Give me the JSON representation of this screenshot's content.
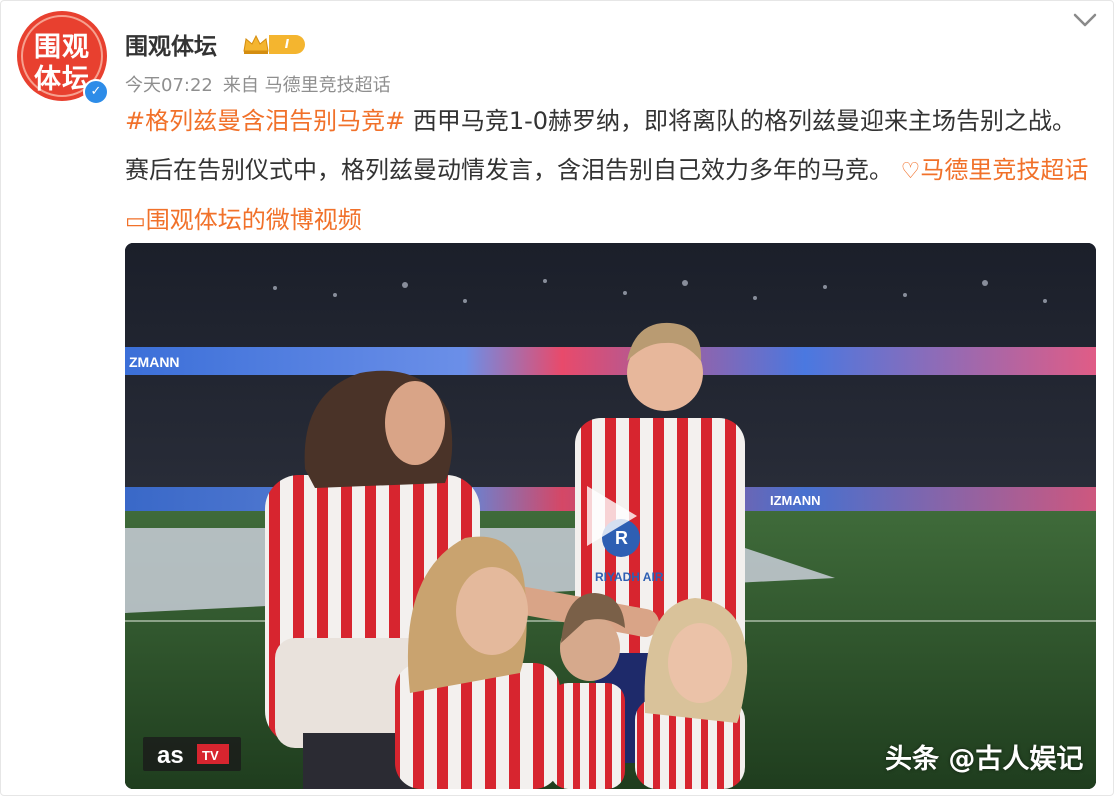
{
  "post": {
    "username": "围观体坛",
    "avatar_line1": "围观",
    "avatar_line2": "体坛",
    "level": "I",
    "time": "今天07:22",
    "source": "来自 马德里竞技超话"
  },
  "content": {
    "hashtag": "#格列兹曼含泪告别马竞#",
    "text": " 西甲马竞1-0赫罗纳，即将离队的格列兹曼迎来主场告别之战。赛后在告别仪式中，格列兹曼动情发言，含泪告别自己效力多年的马竞。",
    "topic_icon": "♡",
    "topic_link": "马德里竞技超话",
    "video_icon": "▭",
    "video_link": "围观体坛的微博视频"
  },
  "video": {
    "banner_left": "ZMANN",
    "banner_right": "IZMANN",
    "channel_logo": "as",
    "channel_tv": "TV",
    "sponsor": "RIYADH AIR"
  },
  "watermark": "头条 @古人娱记",
  "colors": {
    "accent": "#f1712a",
    "avatar_red": "#e8402f",
    "verified_blue": "#2d8ce8",
    "level_gold": "#f4b52f",
    "jersey_red": "#d7252f"
  },
  "icons": {
    "verify": "verified-badge-icon",
    "crown": "crown-icon",
    "chevron": "chevron-down-icon",
    "play": "play-icon"
  }
}
